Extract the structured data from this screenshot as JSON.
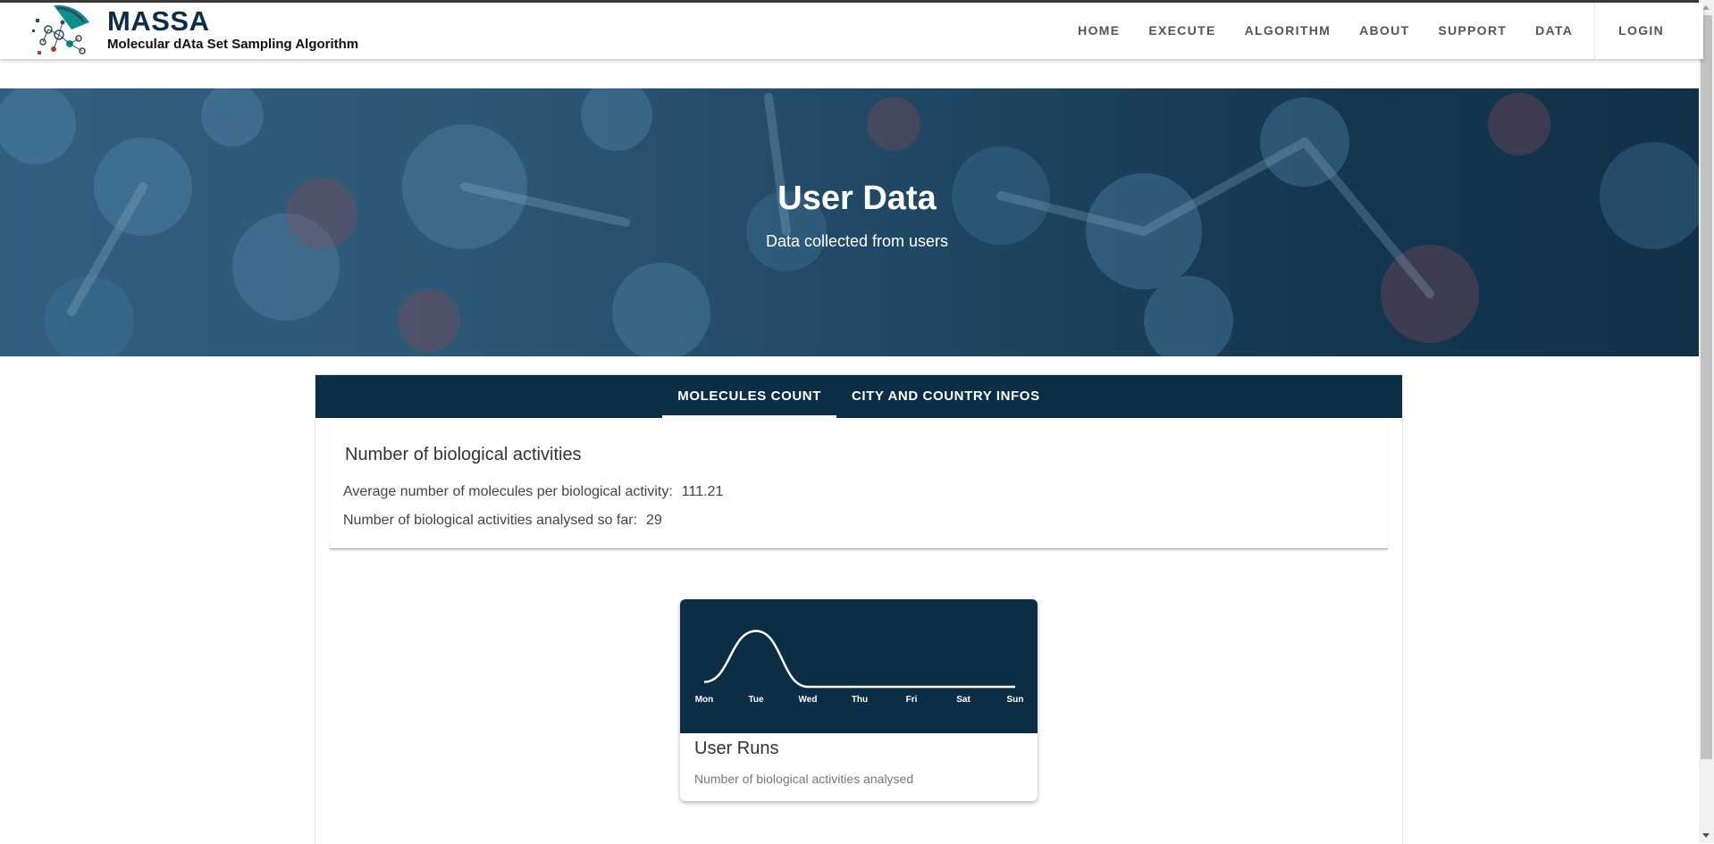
{
  "brand": {
    "title": "MASSA",
    "subtitle": "Molecular dAta Set Sampling Algorithm"
  },
  "nav": {
    "items": [
      "HOME",
      "EXECUTE",
      "ALGORITHM",
      "ABOUT",
      "SUPPORT",
      "DATA"
    ],
    "login": "LOGIN"
  },
  "hero": {
    "title": "User Data",
    "subtitle": "Data collected from users"
  },
  "tabs": [
    {
      "label": "MOLECULES COUNT",
      "active": true
    },
    {
      "label": "CITY AND COUNTRY INFOS",
      "active": false
    }
  ],
  "stats": {
    "heading": "Number of biological activities",
    "avg_label": "Average number of molecules per biological activity:",
    "avg_value": "111.21",
    "count_label": "Number of biological activities analysed so far:",
    "count_value": "29"
  },
  "chart_card": {
    "title": "User Runs",
    "description": "Number of biological activities analysed"
  },
  "chart_data": {
    "type": "line",
    "categories": [
      "Mon",
      "Tue",
      "Wed",
      "Thu",
      "Fri",
      "Sat",
      "Sun"
    ],
    "series": [
      {
        "values": [
          2,
          23,
          0,
          0,
          0,
          0,
          0
        ]
      }
    ],
    "ylim": [
      0,
      25
    ],
    "grid": false,
    "line_color": "#ffffff",
    "background": "#0b2d45"
  },
  "colors": {
    "primary": "#0b2d45",
    "nav_text": "#555555"
  }
}
